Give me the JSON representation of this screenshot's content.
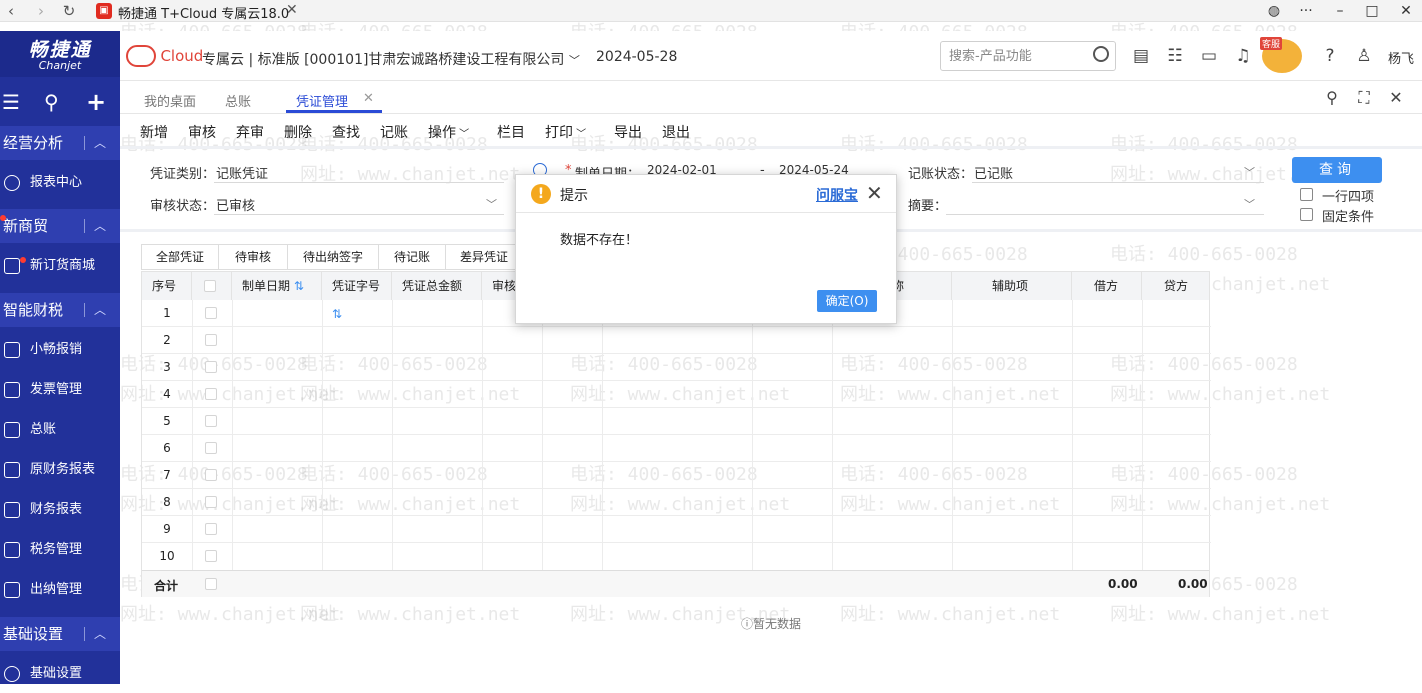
{
  "window": {
    "title": "畅捷通 T+Cloud 专属云18.0"
  },
  "sidebar": {
    "logo_cn": "畅捷通",
    "logo_en": "Chanjet",
    "groups": [
      {
        "label": "经营分析",
        "items": [
          {
            "label": "报表中心"
          }
        ]
      },
      {
        "label": "新商贸",
        "items": [
          {
            "label": "新订货商城"
          }
        ]
      },
      {
        "label": "智能财税",
        "items": [
          {
            "label": "小畅报销"
          },
          {
            "label": "发票管理"
          },
          {
            "label": "总账"
          },
          {
            "label": "原财务报表"
          },
          {
            "label": "财务报表"
          },
          {
            "label": "税务管理"
          },
          {
            "label": "出纳管理"
          }
        ]
      },
      {
        "label": "基础设置",
        "items": [
          {
            "label": "基础设置"
          }
        ]
      }
    ]
  },
  "header": {
    "brand": "Cloud",
    "company": "专属云 | 标准版 [000101]甘肃宏诚路桥建设工程有限公司",
    "date": "2024-05-28",
    "search_placeholder": "搜索-产品功能",
    "mascot_tag": "客服",
    "user": "杨飞"
  },
  "tabs": [
    {
      "label": "我的桌面"
    },
    {
      "label": "总账"
    },
    {
      "label": "凭证管理"
    }
  ],
  "toolbar": [
    "新增",
    "审核",
    "弃审",
    "删除",
    "查找",
    "记账",
    "操作",
    "栏目",
    "打印",
    "导出",
    "退出"
  ],
  "filter": {
    "voucher_type_label": "凭证类别：",
    "voucher_type_value": "记账凭证",
    "audit_status_label": "审核状态：",
    "audit_status_value": "已审核",
    "date_label": "制单日期：",
    "date_from": "2024-02-01",
    "date_to": "2024-05-24",
    "date_sep": "-",
    "post_status_label": "记账状态：",
    "post_status_value": "已记账",
    "summary_label": "摘要：",
    "query": "查询",
    "opt_one_row_four": "一行四项",
    "opt_fixed": "固定条件"
  },
  "subtabs": [
    "全部凭证",
    "待审核",
    "待出纳签字",
    "待记账",
    "差异凭证"
  ],
  "table": {
    "columns": [
      "序号",
      "",
      "制单日期",
      "凭证字号",
      "凭证总金额",
      "审核",
      "",
      "",
      "",
      "称",
      "辅助项",
      "借方",
      "贷方"
    ],
    "rows": [
      "1",
      "2",
      "3",
      "4",
      "5",
      "6",
      "7",
      "8",
      "9",
      "10"
    ],
    "total_label": "合计",
    "total_debit": "0.00",
    "total_credit": "0.00",
    "no_data": "暂无数据"
  },
  "watermark": {
    "phone": "电话: 400-665-0028",
    "site": "网址: www.chanjet.net"
  },
  "dialog": {
    "title": "提示",
    "help_link": "问服宝",
    "message": "数据不存在！",
    "ok": "确定(O)"
  }
}
